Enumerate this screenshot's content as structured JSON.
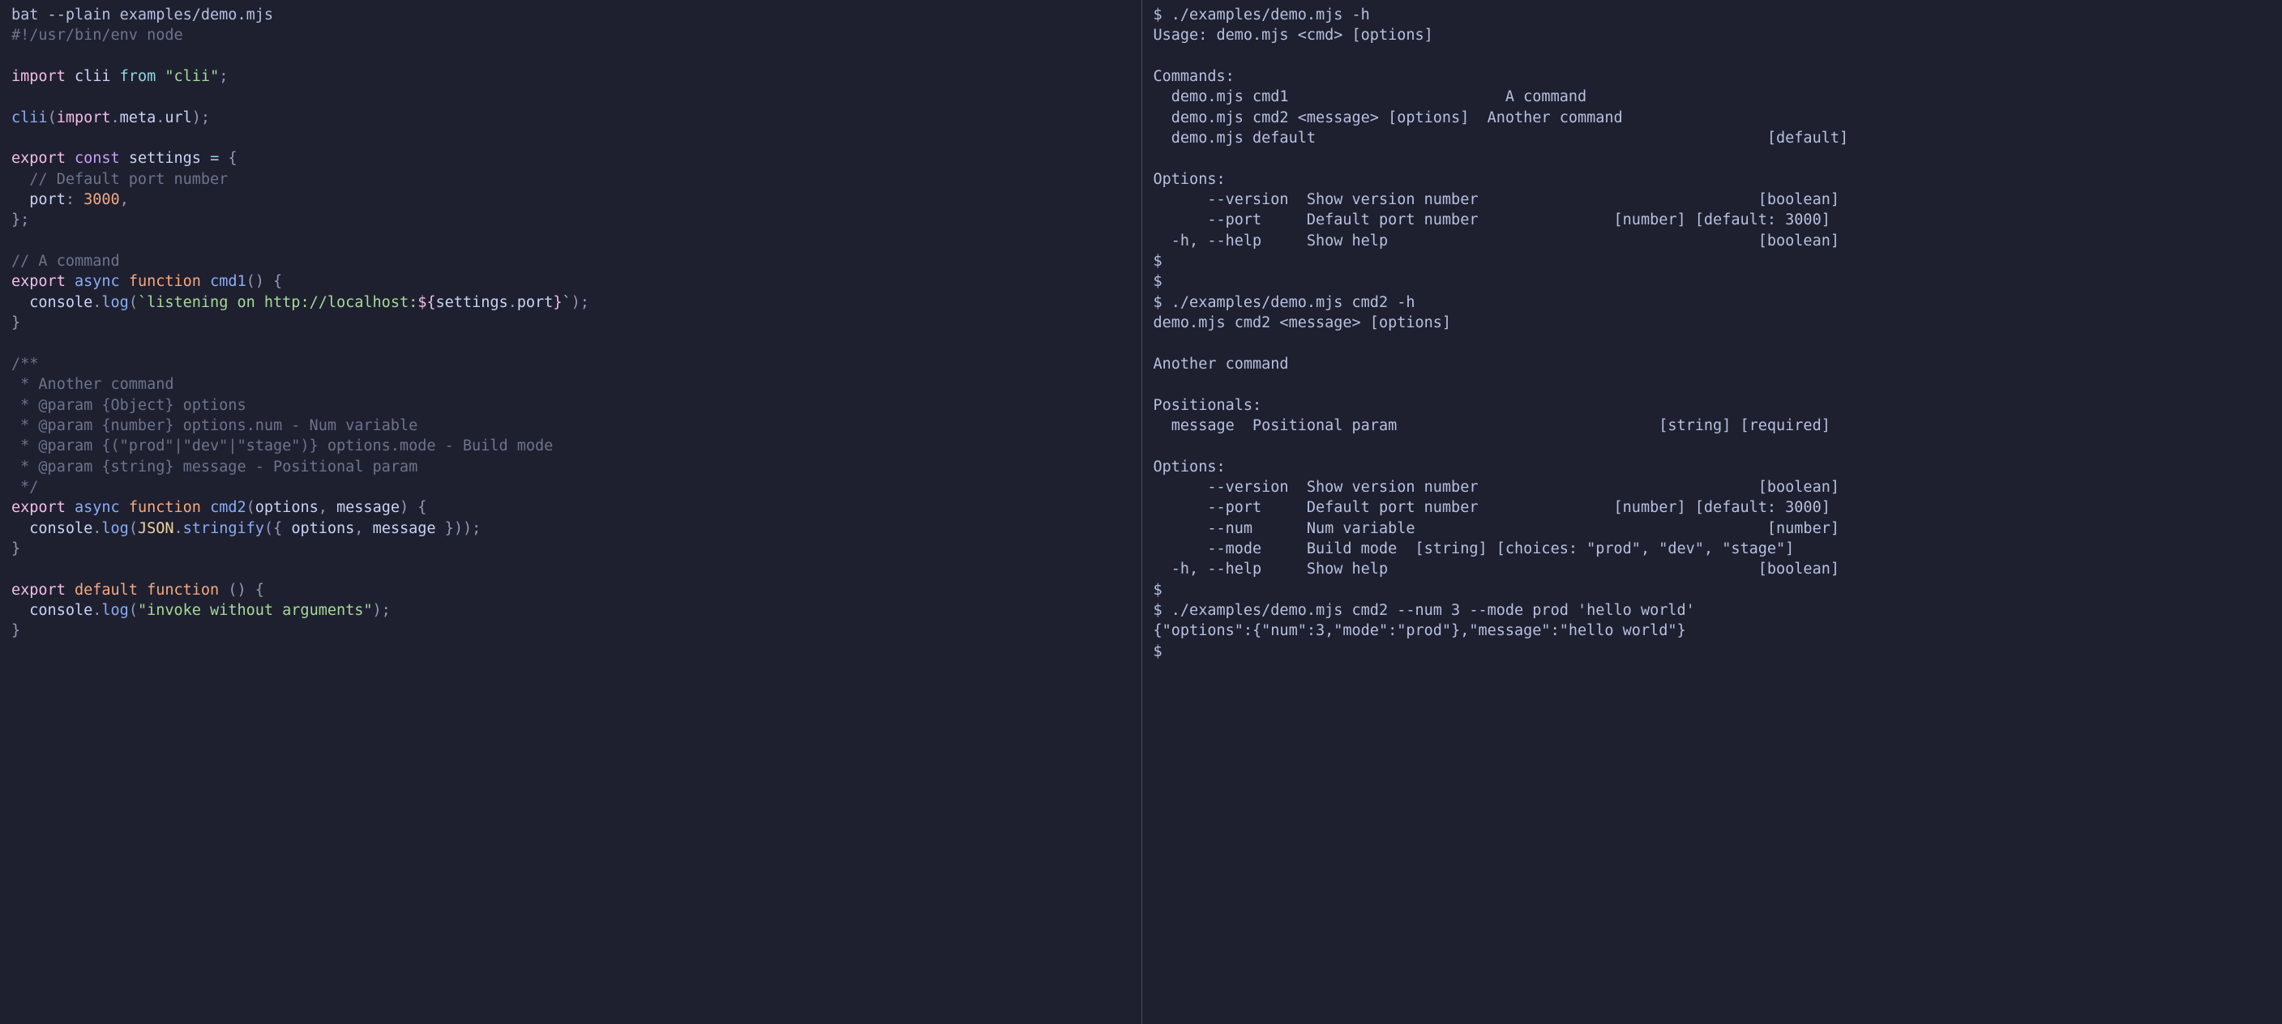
{
  "left": {
    "cmd": "bat --plain examples/demo.mjs",
    "shebang": "#!/usr/bin/env node",
    "import_stmt": {
      "kw": "import",
      "name": "clii",
      "from": "from",
      "module": "\"clii\"",
      "semi": ";"
    },
    "call_line": {
      "fn": "clii",
      "open": "(",
      "import": "import",
      "dot1": ".",
      "meta": "meta",
      "dot2": ".",
      "url": "url",
      "close": ");"
    },
    "settings_decl": {
      "export": "export",
      "const": "const",
      "name": "settings",
      "eq": "=",
      "open": "{",
      "comment": "  // Default port number",
      "port_key": "port",
      "colon": ":",
      "port_val": "3000",
      "comma": ",",
      "close": "};"
    },
    "cmd1_comment": "// A command",
    "cmd1_decl": {
      "export": "export",
      "async": "async",
      "function": "function",
      "name": "cmd1",
      "sig": "() {",
      "body_indent": "  ",
      "console": "console",
      "dot": ".",
      "log": "log",
      "open": "(",
      "tick1": "`",
      "str1": "listening on http://localhost:",
      "interp_open": "${",
      "settings": "settings",
      "dot2": ".",
      "port": "port",
      "interp_close": "}",
      "tick2": "`",
      "close": ");",
      "end": "}"
    },
    "jsdoc": {
      "l1": "/**",
      "l2": " * Another command",
      "l3": " * @param {Object} options",
      "l4": " * @param {number} options.num - Num variable",
      "l5": " * @param {(\"prod\"|\"dev\"|\"stage\")} options.mode - Build mode",
      "l6": " * @param {string} message - Positional param",
      "l7": " */"
    },
    "cmd2_decl": {
      "export": "export",
      "async": "async",
      "function": "function",
      "name": "cmd2",
      "open_paren": "(",
      "p1": "options",
      "comma": ",",
      "p2": "message",
      "close_paren": ") {",
      "indent": "  ",
      "console": "console",
      "dot": ".",
      "log": "log",
      "popen": "(",
      "json": "JSON",
      "dot2": ".",
      "stringify": "stringify",
      "sopen": "({ ",
      "a1": "options",
      "scomma": ",",
      "a2": "message",
      "sclose": " }));",
      "end": "}"
    },
    "default_decl": {
      "export": "export",
      "default": "default",
      "function": "function",
      "sig": "() {",
      "indent": "  ",
      "console": "console",
      "dot": ".",
      "log": "log",
      "popen": "(",
      "str": "\"invoke without arguments\"",
      "pclose": ");",
      "end": "}"
    }
  },
  "right": {
    "lines": [
      "$ ./examples/demo.mjs -h",
      "Usage: demo.mjs <cmd> [options]",
      "",
      "Commands:",
      "  demo.mjs cmd1                        A command",
      "  demo.mjs cmd2 <message> [options]  Another command",
      "  demo.mjs default                                                  [default]",
      "",
      "Options:",
      "      --version  Show version number                               [boolean]",
      "      --port     Default port number               [number] [default: 3000]",
      "  -h, --help     Show help                                         [boolean]",
      "$",
      "$",
      "$ ./examples/demo.mjs cmd2 -h",
      "demo.mjs cmd2 <message> [options]",
      "",
      "Another command",
      "",
      "Positionals:",
      "  message  Positional param                             [string] [required]",
      "",
      "Options:",
      "      --version  Show version number                               [boolean]",
      "      --port     Default port number               [number] [default: 3000]",
      "      --num      Num variable                                       [number]",
      "      --mode     Build mode  [string] [choices: \"prod\", \"dev\", \"stage\"]",
      "  -h, --help     Show help                                         [boolean]",
      "$",
      "$ ./examples/demo.mjs cmd2 --num 3 --mode prod 'hello world'",
      "{\"options\":{\"num\":3,\"mode\":\"prod\"},\"message\":\"hello world\"}",
      "$"
    ]
  }
}
